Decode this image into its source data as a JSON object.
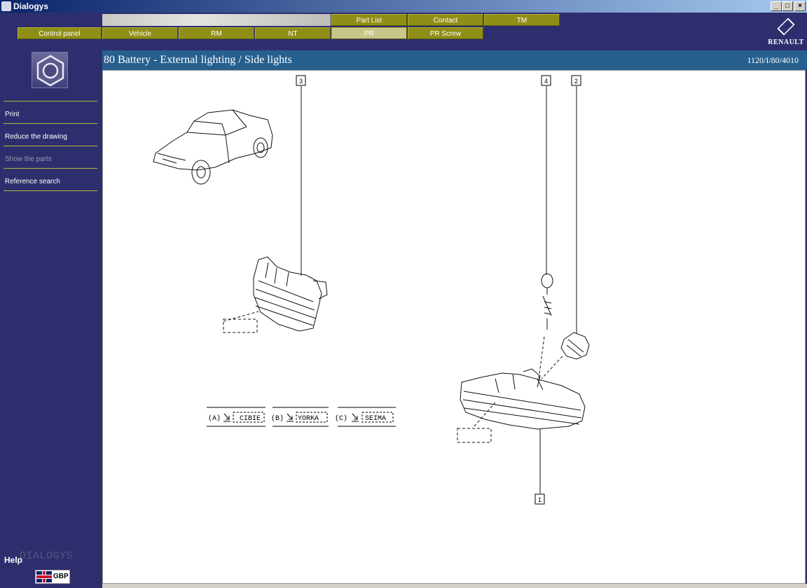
{
  "window": {
    "title": "Dialogys",
    "controls": [
      "_",
      "□",
      "×"
    ]
  },
  "top_tabs": [
    {
      "label": "Part List"
    },
    {
      "label": "Contact"
    },
    {
      "label": "TM"
    }
  ],
  "nav_tabs": [
    {
      "label": "Control panel",
      "active": false
    },
    {
      "label": "Vehicle",
      "active": false
    },
    {
      "label": "RM",
      "active": false
    },
    {
      "label": "NT",
      "active": false
    },
    {
      "label": "PR",
      "active": true
    },
    {
      "label": "PR Screw",
      "active": false
    }
  ],
  "brand": {
    "name": "RENAULT",
    "icon": "renault-diamond-icon"
  },
  "sidebar": {
    "icon": "hex-nut-icon",
    "menu": [
      {
        "label": "Print",
        "enabled": true
      },
      {
        "label": "Reduce the drawing",
        "enabled": true
      },
      {
        "label": "Show the parts",
        "enabled": false
      },
      {
        "label": "Reference search",
        "enabled": true
      }
    ],
    "help": "Help",
    "watermark": "DIALOGYS",
    "language": {
      "code": "GBP",
      "icon": "uk-flag-icon"
    }
  },
  "page": {
    "title": "80 Battery - External lighting / Side lights",
    "reference": "1120/I/80/4010"
  },
  "drawing": {
    "callouts": [
      "3",
      "4",
      "2",
      "1"
    ],
    "suppliers": [
      {
        "prefix": "(A)",
        "name": "CIBIE"
      },
      {
        "prefix": "(B)",
        "name": "YORKA"
      },
      {
        "prefix": "(C)",
        "name": "SEIMA"
      }
    ]
  },
  "colors": {
    "header_bg": "#27608e",
    "sidebar_bg": "#2e2e6e",
    "tab_olive": "#8f8f17",
    "tab_active": "#c7c78a",
    "menu_separator": "#b5b53a"
  }
}
